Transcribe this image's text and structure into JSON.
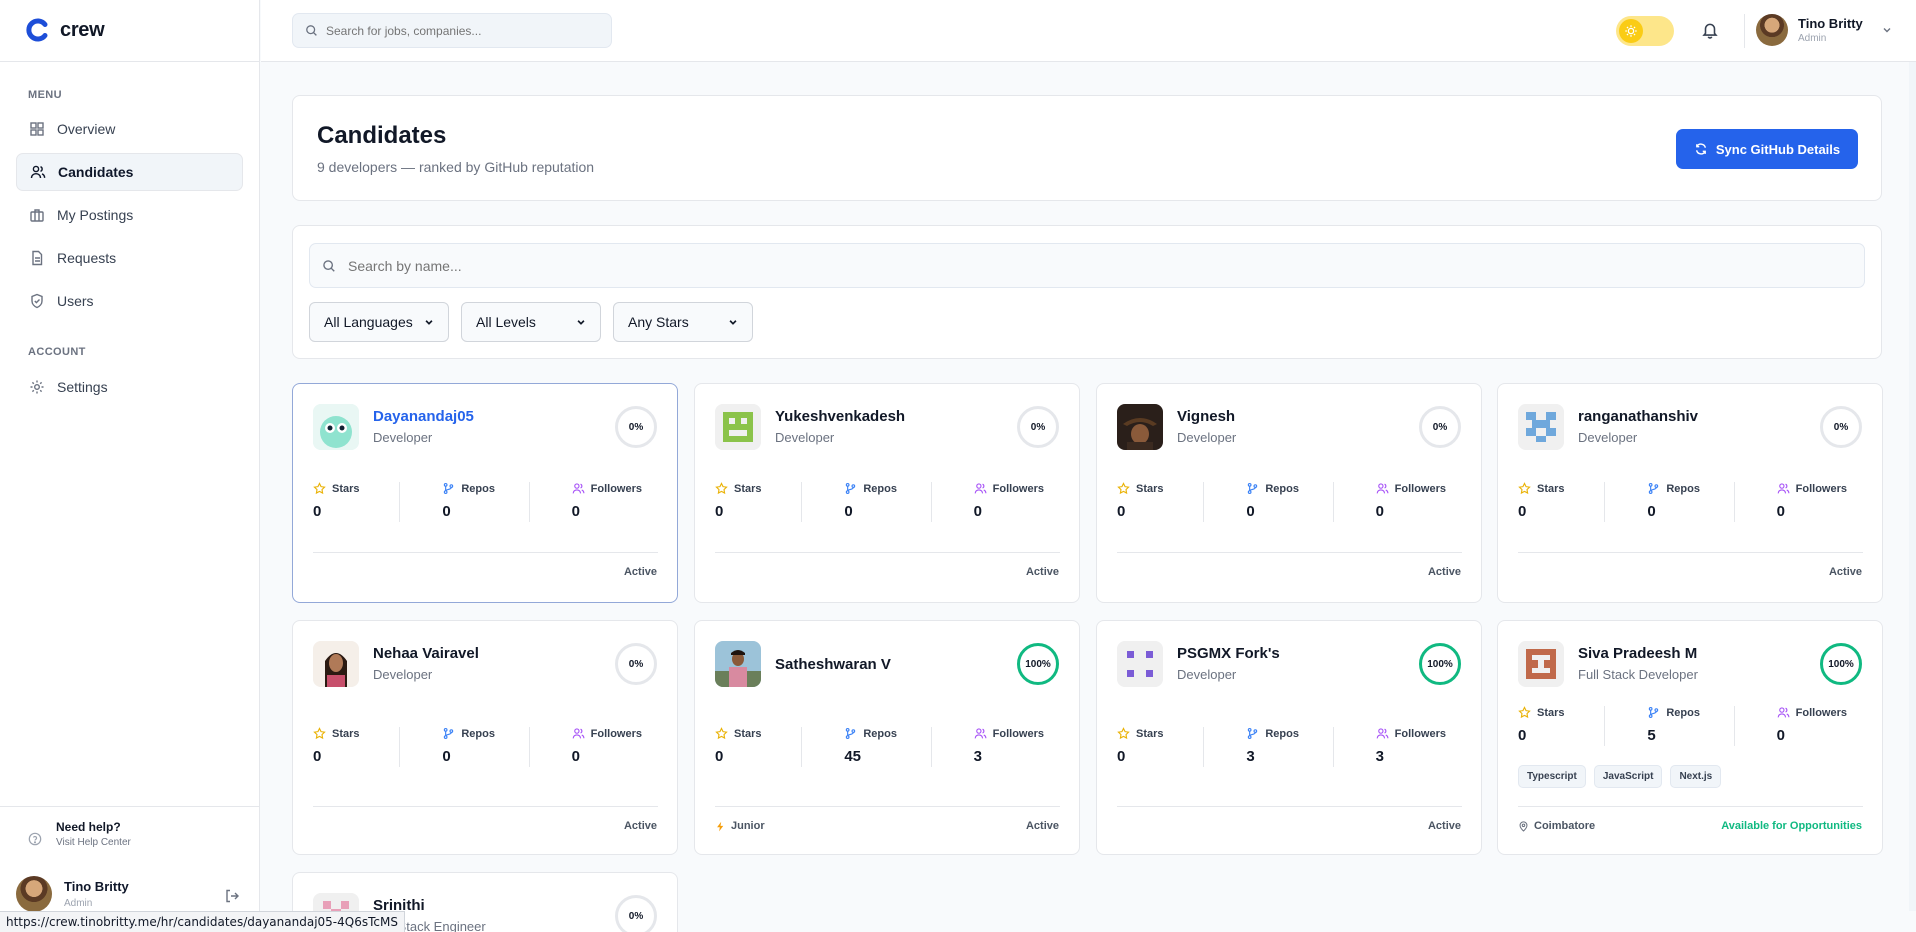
{
  "app": {
    "name": "crew"
  },
  "sidebar": {
    "menu_label": "MENU",
    "items": [
      {
        "label": "Overview",
        "icon": "grid-icon"
      },
      {
        "label": "Candidates",
        "icon": "users-icon"
      },
      {
        "label": "My Postings",
        "icon": "briefcase-icon"
      },
      {
        "label": "Requests",
        "icon": "document-icon"
      },
      {
        "label": "Users",
        "icon": "shield-icon"
      }
    ],
    "account_label": "ACCOUNT",
    "settings_label": "Settings",
    "help_title": "Need help?",
    "help_sub": "Visit Help Center",
    "user_name": "Tino Britty",
    "user_role": "Admin"
  },
  "topbar": {
    "search_placeholder": "Search for jobs, companies...",
    "user_name": "Tino Britty",
    "user_role": "Admin"
  },
  "header": {
    "title": "Candidates",
    "subtitle": "9 developers — ranked by GitHub reputation",
    "sync_label": "Sync GitHub Details"
  },
  "filters": {
    "search_placeholder": "Search by name...",
    "language": "All Languages",
    "level": "All Levels",
    "stars": "Any Stars"
  },
  "stat_labels": {
    "stars": "Stars",
    "repos": "Repos",
    "followers": "Followers"
  },
  "candidates": [
    {
      "name": "Dayanandaj05",
      "role": "Developer",
      "score": "0%",
      "stars": "0",
      "repos": "0",
      "followers": "0",
      "status": "Active"
    },
    {
      "name": "Yukeshvenkadesh",
      "role": "Developer",
      "score": "0%",
      "stars": "0",
      "repos": "0",
      "followers": "0",
      "status": "Active"
    },
    {
      "name": "Vignesh",
      "role": "Developer",
      "score": "0%",
      "stars": "0",
      "repos": "0",
      "followers": "0",
      "status": "Active"
    },
    {
      "name": "ranganathanshiv",
      "role": "Developer",
      "score": "0%",
      "stars": "0",
      "repos": "0",
      "followers": "0",
      "status": "Active"
    },
    {
      "name": "Nehaa Vairavel",
      "role": "Developer",
      "score": "0%",
      "stars": "0",
      "repos": "0",
      "followers": "0",
      "status": "Active"
    },
    {
      "name": "Satheshwaran V",
      "role": "",
      "score": "100%",
      "stars": "0",
      "repos": "45",
      "followers": "3",
      "status": "Active",
      "level": "Junior"
    },
    {
      "name": "PSGMX Fork's",
      "role": "Developer",
      "score": "100%",
      "stars": "0",
      "repos": "3",
      "followers": "3",
      "status": "Active"
    },
    {
      "name": "Siva Pradeesh M",
      "role": "Full Stack Developer",
      "score": "100%",
      "stars": "0",
      "repos": "5",
      "followers": "0",
      "tags": [
        "Typescript",
        "JavaScript",
        "Next.js"
      ],
      "location": "Coimbatore",
      "availability": "Available for Opportunities"
    },
    {
      "name": "Srinithi",
      "role": "Full Stack Engineer",
      "score": "0%"
    }
  ],
  "statusbar": {
    "url": "https://crew.tinobritty.me/hr/candidates/dayanandaj05-4Q6sTcMS"
  },
  "colors": {
    "accent": "#2563eb",
    "success": "#10b981"
  }
}
